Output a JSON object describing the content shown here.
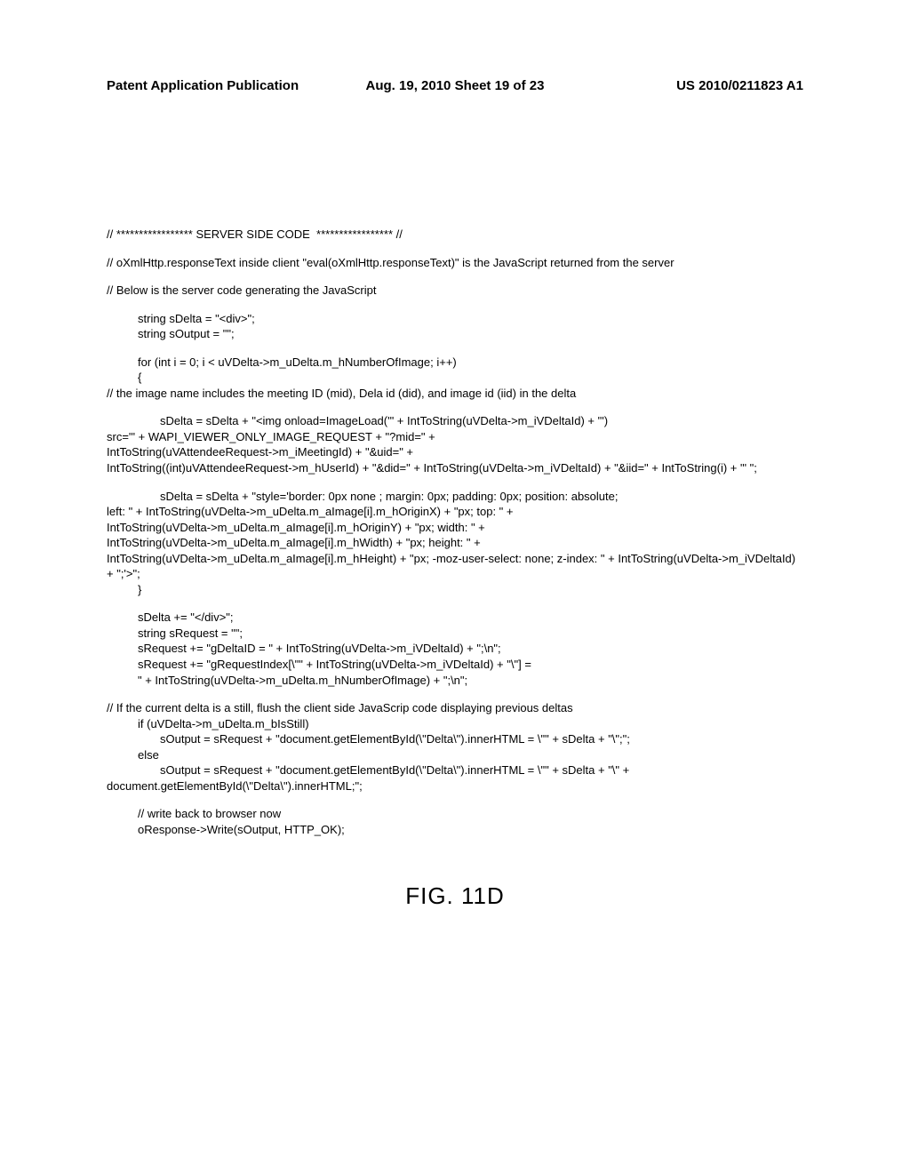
{
  "header": {
    "left": "Patent Application Publication",
    "center": "Aug. 19, 2010  Sheet 19 of 23",
    "right": "US 2010/0211823 A1"
  },
  "code": {
    "c1": "// ***************** SERVER SIDE CODE  ***************** //",
    "c2": "// oXmlHttp.responseText inside client \"eval(oXmlHttp.responseText)\" is the JavaScript returned from the server",
    "c3": "// Below is the server code generating the JavaScript",
    "c4": "string sDelta = \"<div>\";\nstring sOutput = \"\";",
    "c5": "for (int i = 0; i < uVDelta->m_uDelta.m_hNumberOfImage; i++)\n{",
    "c6": "// the image name includes the meeting ID (mid), Dela id (did), and image id (iid) in the delta",
    "c7a": "sDelta = sDelta + \"<img onload=ImageLoad('\" + IntToString(uVDelta->m_iVDeltaId) + \"')",
    "c7b": "src='\" + WAPI_VIEWER_ONLY_IMAGE_REQUEST + \"?mid=\" +\nIntToString(uVAttendeeRequest->m_iMeetingId) + \"&uid=\" +\nIntToString((int)uVAttendeeRequest->m_hUserId) + \"&did=\" + IntToString(uVDelta->m_iVDeltaId) + \"&iid=\" + IntToString(i) + \"' \";",
    "c8a": "sDelta = sDelta + \"style='border: 0px none ; margin: 0px; padding: 0px; position: absolute;",
    "c8b": "left: \" + IntToString(uVDelta->m_uDelta.m_aImage[i].m_hOriginX) + \"px; top: \" +\nIntToString(uVDelta->m_uDelta.m_aImage[i].m_hOriginY) + \"px; width: \" +\nIntToString(uVDelta->m_uDelta.m_aImage[i].m_hWidth) + \"px; height: \" +\nIntToString(uVDelta->m_uDelta.m_aImage[i].m_hHeight) + \"px; -moz-user-select: none; z-index: \" + IntToString(uVDelta->m_iVDeltaId) + \";'>\";",
    "c9": "}",
    "c10": "sDelta += \"</div>\";\nstring sRequest = \"\";\nsRequest += \"gDeltaID = \" + IntToString(uVDelta->m_iVDeltaId) + \";\\n\";\nsRequest += \"gRequestIndex[\\\"\" + IntToString(uVDelta->m_iVDeltaId) + \"\\\"] =\n\" + IntToString(uVDelta->m_uDelta.m_hNumberOfImage) + \";\\n\";",
    "c11": "// If the current delta is a still, flush the client side JavaScrip code displaying previous deltas",
    "c12": "if (uVDelta->m_uDelta.m_bIsStill)",
    "c13": "sOutput = sRequest + \"document.getElementById(\\\"Delta\\\").innerHTML = \\\"\" + sDelta + \"\\\";\";",
    "c14": "else",
    "c15a": "sOutput = sRequest + \"document.getElementById(\\\"Delta\\\").innerHTML = \\\"\" + sDelta + \"\\\" +",
    "c15b": "document.getElementById(\\\"Delta\\\").innerHTML;\";",
    "c16": "// write back to browser now\noResponse->Write(sOutput, HTTP_OK);"
  },
  "figure": "FIG. 11D"
}
